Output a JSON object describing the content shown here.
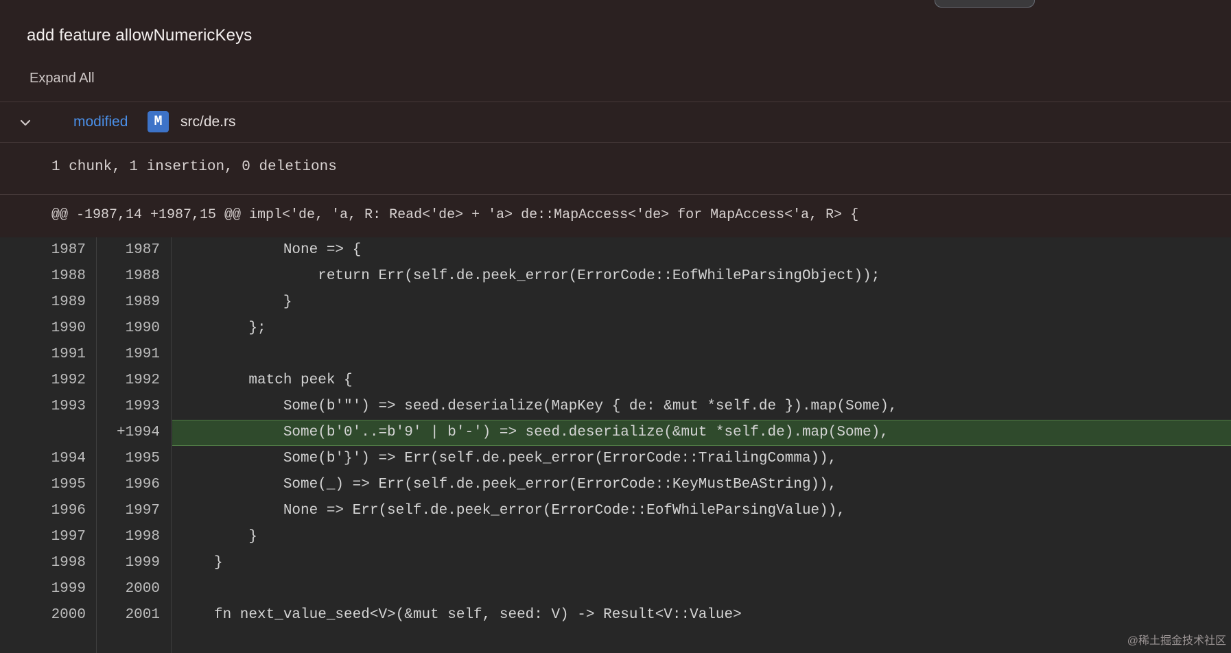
{
  "commit": {
    "title": "add feature allowNumericKeys"
  },
  "toolbar": {
    "expand_all_label": "Expand All"
  },
  "file": {
    "status": "modified",
    "badge": "M",
    "path": "src/de.rs",
    "collapse_icon": "chevron-down-icon"
  },
  "diff": {
    "summary": "1 chunk, 1 insertion, 0 deletions",
    "hunk_header": "@@ -1987,14 +1987,15 @@ impl<'de, 'a, R: Read<'de> + 'a> de::MapAccess<'de> for MapAccess<'a, R> {",
    "lines": [
      {
        "old": "1987",
        "new": "1987",
        "added": false,
        "code": "        None => {"
      },
      {
        "old": "1988",
        "new": "1988",
        "added": false,
        "code": "            return Err(self.de.peek_error(ErrorCode::EofWhileParsingObject));"
      },
      {
        "old": "1989",
        "new": "1989",
        "added": false,
        "code": "        }"
      },
      {
        "old": "1990",
        "new": "1990",
        "added": false,
        "code": "    };"
      },
      {
        "old": "1991",
        "new": "1991",
        "added": false,
        "code": ""
      },
      {
        "old": "1992",
        "new": "1992",
        "added": false,
        "code": "    match peek {"
      },
      {
        "old": "1993",
        "new": "1993",
        "added": false,
        "code": "        Some(b'\"') => seed.deserialize(MapKey { de: &mut *self.de }).map(Some),"
      },
      {
        "old": "",
        "new": "+1994",
        "added": true,
        "code": "        Some(b'0'..=b'9' | b'-') => seed.deserialize(&mut *self.de).map(Some),"
      },
      {
        "old": "1994",
        "new": "1995",
        "added": false,
        "code": "        Some(b'}') => Err(self.de.peek_error(ErrorCode::TrailingComma)),"
      },
      {
        "old": "1995",
        "new": "1996",
        "added": false,
        "code": "        Some(_) => Err(self.de.peek_error(ErrorCode::KeyMustBeAString)),"
      },
      {
        "old": "1996",
        "new": "1997",
        "added": false,
        "code": "        None => Err(self.de.peek_error(ErrorCode::EofWhileParsingValue)),"
      },
      {
        "old": "1997",
        "new": "1998",
        "added": false,
        "code": "    }"
      },
      {
        "old": "1998",
        "new": "1999",
        "added": false,
        "code": "}"
      },
      {
        "old": "1999",
        "new": "2000",
        "added": false,
        "code": ""
      },
      {
        "old": "2000",
        "new": "2001",
        "added": false,
        "code": "fn next_value_seed<V>(&mut self, seed: V) -> Result<V::Value>"
      }
    ]
  },
  "watermark": "@稀土掘金技术社区",
  "colors": {
    "background": "#2b2121",
    "code_background": "#272727",
    "added_line": "#2f4a2c",
    "modified_text": "#4a8fe8",
    "badge": "#3d73c8"
  }
}
